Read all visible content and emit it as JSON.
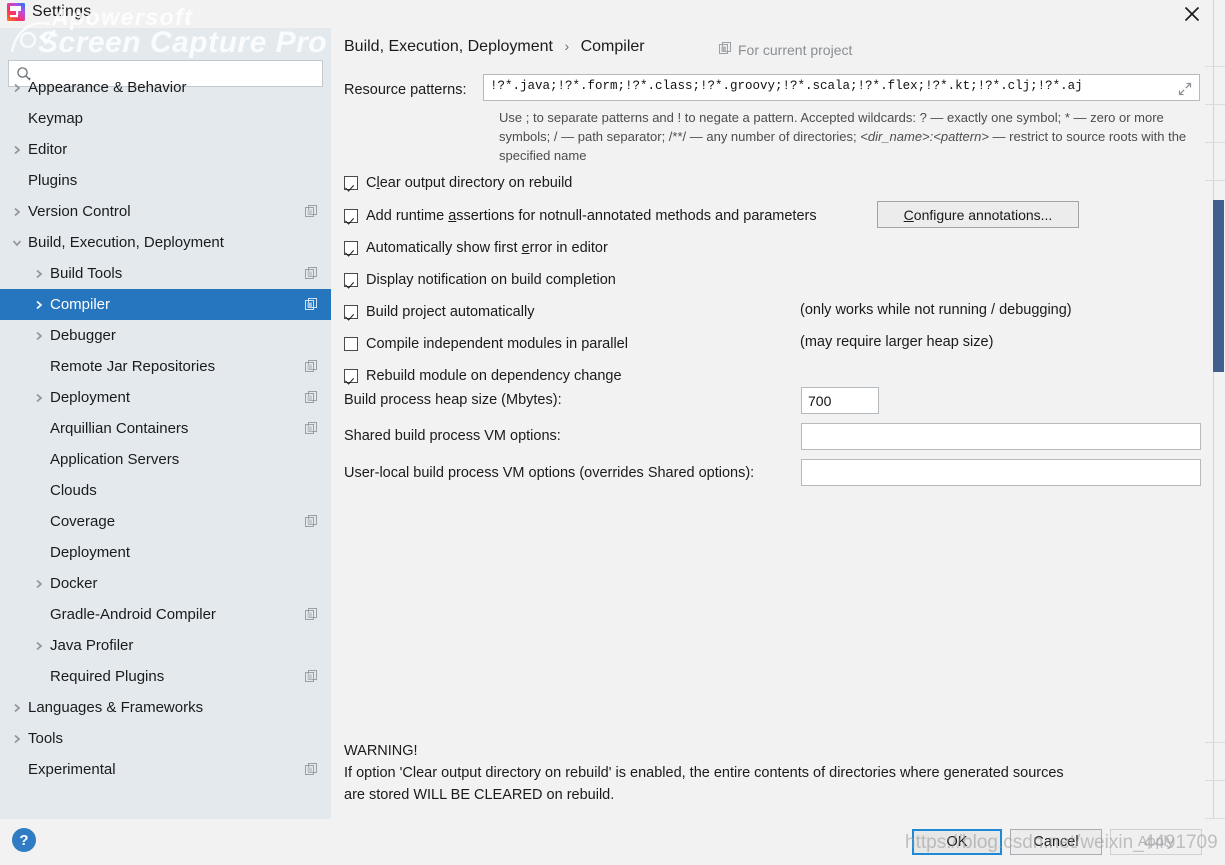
{
  "window": {
    "title": "Settings",
    "app_icon": "intellij-idea-icon",
    "close_icon": "close-icon"
  },
  "search": {
    "value": "",
    "placeholder": "",
    "icon": "search-icon"
  },
  "sidebar": {
    "items": [
      {
        "label": "Appearance & Behavior",
        "level": 0,
        "arrow": "collapsed",
        "project_icon": false,
        "selected": false
      },
      {
        "label": "Keymap",
        "level": 0,
        "arrow": "none",
        "project_icon": false,
        "selected": false
      },
      {
        "label": "Editor",
        "level": 0,
        "arrow": "collapsed",
        "project_icon": false,
        "selected": false
      },
      {
        "label": "Plugins",
        "level": 0,
        "arrow": "none",
        "project_icon": false,
        "selected": false
      },
      {
        "label": "Version Control",
        "level": 0,
        "arrow": "collapsed",
        "project_icon": true,
        "selected": false
      },
      {
        "label": "Build, Execution, Deployment",
        "level": 0,
        "arrow": "expanded",
        "project_icon": false,
        "selected": false
      },
      {
        "label": "Build Tools",
        "level": 1,
        "arrow": "collapsed",
        "project_icon": true,
        "selected": false
      },
      {
        "label": "Compiler",
        "level": 1,
        "arrow": "collapsed",
        "project_icon": true,
        "selected": true
      },
      {
        "label": "Debugger",
        "level": 1,
        "arrow": "collapsed",
        "project_icon": false,
        "selected": false
      },
      {
        "label": "Remote Jar Repositories",
        "level": 1,
        "arrow": "none",
        "project_icon": true,
        "selected": false
      },
      {
        "label": "Deployment",
        "level": 1,
        "arrow": "collapsed",
        "project_icon": true,
        "selected": false
      },
      {
        "label": "Arquillian Containers",
        "level": 1,
        "arrow": "none",
        "project_icon": true,
        "selected": false
      },
      {
        "label": "Application Servers",
        "level": 1,
        "arrow": "none",
        "project_icon": false,
        "selected": false
      },
      {
        "label": "Clouds",
        "level": 1,
        "arrow": "none",
        "project_icon": false,
        "selected": false
      },
      {
        "label": "Coverage",
        "level": 1,
        "arrow": "none",
        "project_icon": true,
        "selected": false
      },
      {
        "label": "Deployment",
        "level": 1,
        "arrow": "none",
        "project_icon": false,
        "selected": false
      },
      {
        "label": "Docker",
        "level": 1,
        "arrow": "collapsed",
        "project_icon": false,
        "selected": false
      },
      {
        "label": "Gradle-Android Compiler",
        "level": 1,
        "arrow": "none",
        "project_icon": true,
        "selected": false
      },
      {
        "label": "Java Profiler",
        "level": 1,
        "arrow": "collapsed",
        "project_icon": false,
        "selected": false
      },
      {
        "label": "Required Plugins",
        "level": 1,
        "arrow": "none",
        "project_icon": true,
        "selected": false
      },
      {
        "label": "Languages & Frameworks",
        "level": 0,
        "arrow": "collapsed",
        "project_icon": false,
        "selected": false
      },
      {
        "label": "Tools",
        "level": 0,
        "arrow": "collapsed",
        "project_icon": false,
        "selected": false
      },
      {
        "label": "Experimental",
        "level": 0,
        "arrow": "none",
        "project_icon": true,
        "selected": false
      }
    ],
    "selected_color": "#2675bf",
    "background_color": "#e4e9ee"
  },
  "breadcrumb": {
    "root": "Build, Execution, Deployment",
    "separator": "›",
    "leaf": "Compiler"
  },
  "for_current_project": {
    "label": "For current project",
    "icon": "project-scope-icon"
  },
  "resource_patterns": {
    "label": "Resource patterns:",
    "value": "!?*.java;!?*.form;!?*.class;!?*.groovy;!?*.scala;!?*.flex;!?*.kt;!?*.clj;!?*.aj",
    "expand_icon": "expand-diagonal-icon",
    "hint_part1": "Use ; to separate patterns and ! to negate a pattern. Accepted wildcards: ? — exactly one symbol; * — zero or more symbols; / — path separator; /**/ — any number of directories; ",
    "hint_italic": "<dir_name>:<pattern>",
    "hint_part2": " — restrict to source roots with the specified name"
  },
  "options": [
    {
      "label_pre": "C",
      "label_mnemonic": "l",
      "label_post": "ear output directory on rebuild",
      "checked": true,
      "note": ""
    },
    {
      "label_pre": "Add runtime ",
      "label_mnemonic": "a",
      "label_post": "ssertions for notnull-annotated methods and parameters",
      "checked": true,
      "note": ""
    },
    {
      "label_pre": "Automatically show first ",
      "label_mnemonic": "e",
      "label_post": "rror in editor",
      "checked": true,
      "note": ""
    },
    {
      "label_pre": "Display notification on build completion",
      "label_mnemonic": "",
      "label_post": "",
      "checked": true,
      "note": ""
    },
    {
      "label_pre": "Build project automatically",
      "label_mnemonic": "",
      "label_post": "",
      "checked": true,
      "note": "(only works while not running / debugging)"
    },
    {
      "label_pre": "Compile independent modules in parallel",
      "label_mnemonic": "",
      "label_post": "",
      "checked": false,
      "note": "(may require larger heap size)"
    },
    {
      "label_pre": "Rebuild module on dependency change",
      "label_mnemonic": "",
      "label_post": "",
      "checked": true,
      "note": ""
    }
  ],
  "configure_annotations": {
    "label_pre": "",
    "label_mnemonic": "C",
    "label_post": "onfigure annotations..."
  },
  "fields": [
    {
      "label": "Build process heap size (Mbytes):",
      "value": "700",
      "placeholder": ""
    },
    {
      "label": "Shared build process VM options:",
      "value": "",
      "placeholder": ""
    },
    {
      "label": "User-local build process VM options (overrides Shared options):",
      "value": "",
      "placeholder": ""
    }
  ],
  "warning": {
    "heading": "WARNING!",
    "line1": "If option 'Clear output directory on rebuild' is enabled, the entire contents of directories where generated sources",
    "line2": "are stored WILL BE CLEARED on rebuild."
  },
  "footer": {
    "help_label": "?",
    "ok_label": "OK",
    "cancel_label": "Cancel",
    "apply_label": "Apply",
    "apply_disabled": true,
    "ok_focus_color": "#1e8ad6"
  },
  "scrollbar": {
    "thumb_color": "#42608f",
    "track_color": "#f2f2f2"
  },
  "watermarks": {
    "brand_line1": "Apowersoft",
    "brand_line2": "Screen Capture Pro",
    "url": "https://blog.csdn.net/weixin_4491709"
  }
}
